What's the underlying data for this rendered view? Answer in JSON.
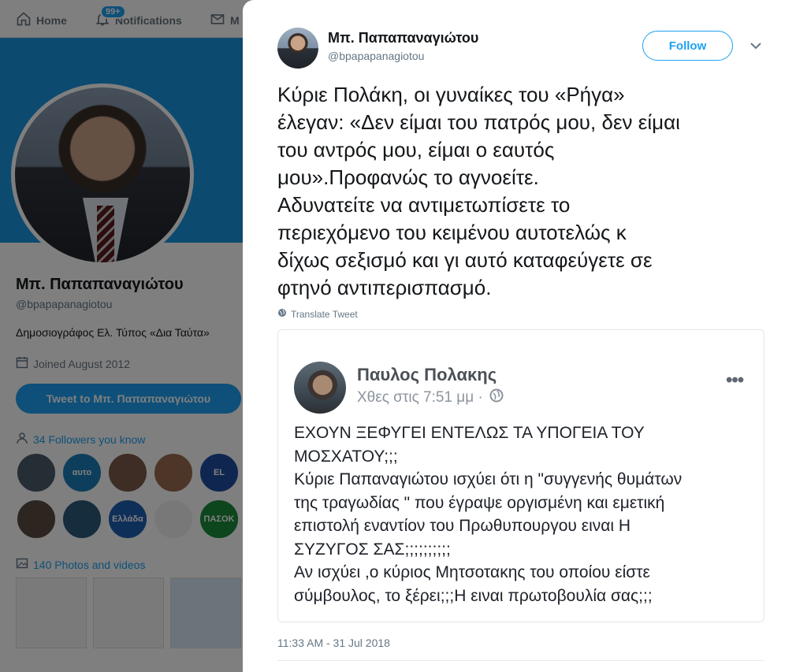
{
  "background": {
    "nav": {
      "home_label": "Home",
      "notifications_label": "Notifications",
      "notifications_badge": "99+",
      "messages_label": "M"
    },
    "profile": {
      "name": "Μπ. Παπαπαναγιώτου",
      "handle": "@bpapapanagiotou",
      "bio": "Δημοσιογράφος Ελ. Τύπος «Δια Ταύτα»",
      "joined": "Joined August 2012",
      "tweet_to_label": "Tweet to Μπ. Παπαπαναγιώτου",
      "followers_you_know": "34 Followers you know",
      "followers_faces": [
        {
          "label": "",
          "color": "#4a5a6a"
        },
        {
          "label": "αυτο",
          "color": "#1b7fb8"
        },
        {
          "label": "",
          "color": "#7a5a4a"
        },
        {
          "label": "",
          "color": "#9a6a50"
        },
        {
          "label": "EL",
          "color": "#1f4fa0"
        },
        {
          "label": "",
          "color": "#5a4a40"
        },
        {
          "label": "",
          "color": "#2a5a7a"
        },
        {
          "label": "Ελλάδα",
          "color": "#1d5fb0"
        },
        {
          "label": "",
          "color": "#f0f0f0"
        },
        {
          "label": "ΠΑΣΟΚ",
          "color": "#1a8a3a"
        }
      ],
      "photos_videos": "140 Photos and videos"
    },
    "colors": {
      "twitter_blue": "#1da1f2",
      "banner": "#1b95e0"
    }
  },
  "tweet": {
    "author_name": "Μπ. Παπαπαναγιώτου",
    "author_handle": "@bpapapanagiotou",
    "follow_label": "Follow",
    "text": "Κύριε Πολάκη, οι γυναίκες του «Ρήγα»\nέλεγαν: «Δεν είμαι του πατρός μου, δεν είμαι\nτου αντρός μου, είμαι ο εαυτός\nμου».Προφανώς το αγνοείτε.\nΑδυνατείτε να αντιμετωπίσετε το\nπεριεχόμενο του κειμένου αυτοτελώς κ\nδίχως σεξισμό και γι αυτό καταφεύγετε σε\nφτηνό αντιπερισπασμό.",
    "translate_label": "Translate Tweet",
    "timestamp": "11:33 AM - 31 Jul 2018",
    "embedded_post": {
      "name": "Παυλος Πολακης",
      "time": "Χθες στις 7:51 μμ ·",
      "more": "•••",
      "text": "ΕΧΟΥΝ ΞΕΦΥΓΕΙ ΕΝΤΕΛΩΣ ΤΑ ΥΠΟΓΕΙΑ ΤΟΥ\nΜΟΣΧΑΤΟΥ;;;\nΚύριε Παπαναγιώτου ισχύει ότι η \"συγγενής θυμάτων\nτης τραγωδίας \" που έγραψε οργισμένη και εμετική\nεπιστολή εναντίον του Πρωθυπουργου ειναι Η\nΣΥΖΥΓΟΣ ΣΑΣ;;;;;;;;;;\nΑν ισχύει ,ο κύριος Μητσοτακης του οποίου είστε\nσύμβουλος, το ξέρει;;;Η ειναι πρωτοβουλία σας;;;"
    }
  }
}
